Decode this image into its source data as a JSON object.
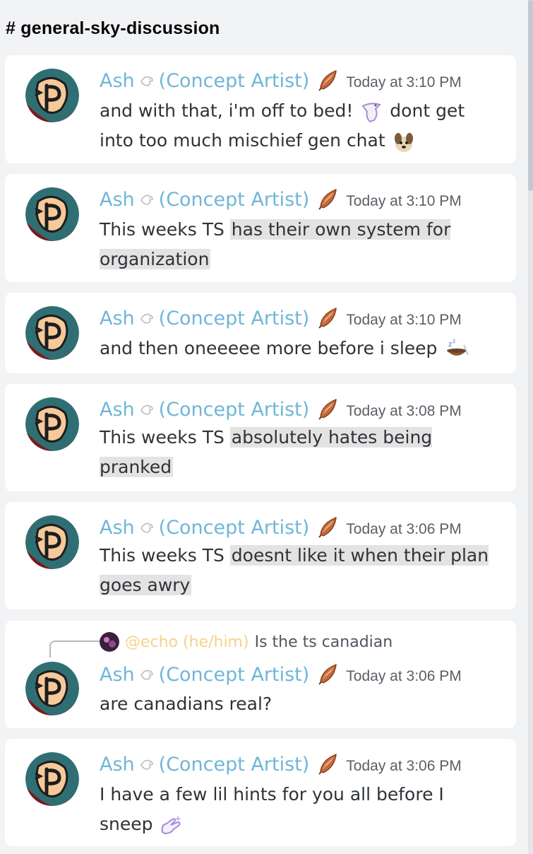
{
  "channel": {
    "title": "# general-sky-discussion"
  },
  "colors": {
    "author": "#6fb6d8",
    "reply_user": "#f5d38a",
    "highlight": "#e3e3e3"
  },
  "messages": [
    {
      "author": "Ash",
      "role": "(Concept Artist)",
      "time": "Today at 3:10 PM",
      "parts": [
        "and with that, i'm off to bed! ",
        " dont get into too much mischief gen chat "
      ],
      "emojis": [
        "bird-sticker-icon",
        "puppy-emoji-icon"
      ]
    },
    {
      "author": "Ash",
      "role": "(Concept Artist)",
      "time": "Today at 3:10 PM",
      "plain": "This weeks TS ",
      "highlight": "has their own system for organization"
    },
    {
      "author": "Ash",
      "role": "(Concept Artist)",
      "time": "Today at 3:10 PM",
      "text": "and then oneeeee more before i sleep",
      "emojis": [
        "sleeping-bowl-icon"
      ]
    },
    {
      "author": "Ash",
      "role": "(Concept Artist)",
      "time": "Today at 3:08 PM",
      "plain": "This weeks TS ",
      "highlight": "absolutely hates being pranked"
    },
    {
      "author": "Ash",
      "role": "(Concept Artist)",
      "time": "Today at 3:06 PM",
      "plain": "This weeks TS ",
      "highlight": "doesnt like it when their plan goes awry"
    },
    {
      "author": "Ash",
      "role": "(Concept Artist)",
      "time": "Today at 3:06 PM",
      "reply": {
        "user": "@echo (he/him)",
        "text": "Is the ts canadian"
      },
      "text": "are canadians real?"
    },
    {
      "author": "Ash",
      "role": "(Concept Artist)",
      "time": "Today at 3:06 PM",
      "text": "I have a few lil hints for you all before I sneep",
      "emojis": [
        "sparkle-hand-icon"
      ]
    }
  ]
}
